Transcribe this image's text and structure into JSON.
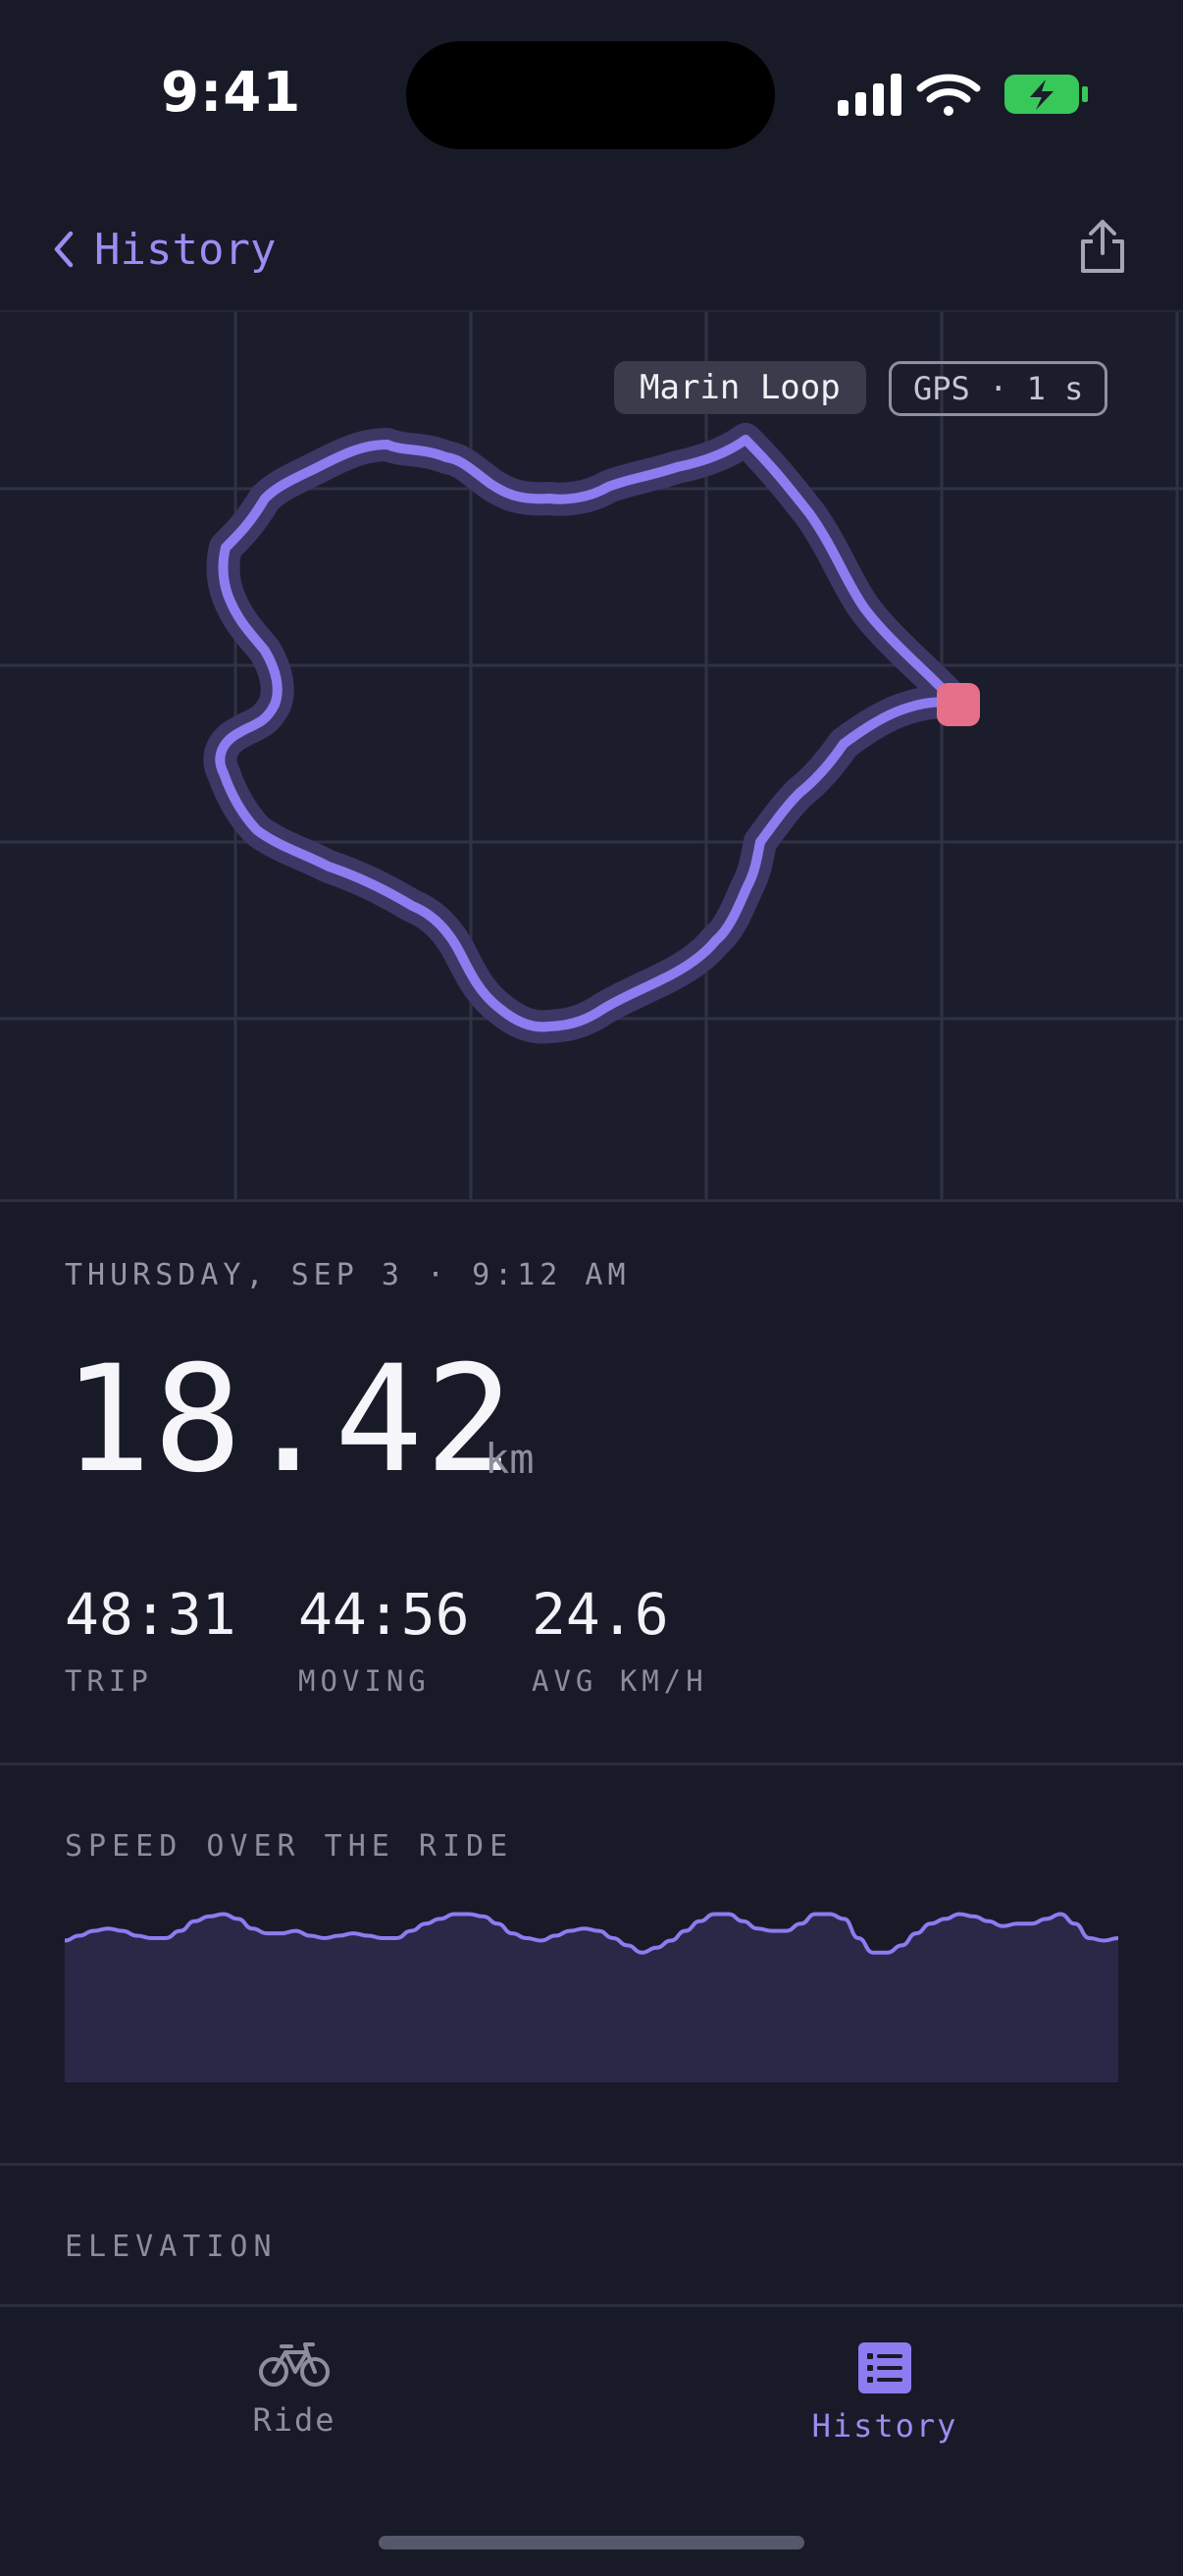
{
  "status_bar": {
    "time": "9:41"
  },
  "nav": {
    "back_label": "History"
  },
  "map": {
    "route_name": "Marin Loop",
    "gps_label": "GPS · 1 s",
    "colors": {
      "route": "#8b7cf0",
      "route_halo": "#3d3766",
      "marker": "#e6708a",
      "grid": "#2f3244"
    }
  },
  "ride": {
    "date": "THURSDAY, SEP 3 · 9:12 AM",
    "distance": "18.42",
    "distance_unit": "km",
    "stats": [
      {
        "value": "48:31",
        "label": "TRIP"
      },
      {
        "value": "44:56",
        "label": "MOVING"
      },
      {
        "value": "24.6",
        "label": "AVG KM/H"
      }
    ]
  },
  "sections": {
    "speed_title": "SPEED OVER THE RIDE",
    "elevation_title": "ELEVATION"
  },
  "chart_data": {
    "type": "area",
    "title": "SPEED OVER THE RIDE",
    "xlabel": "",
    "ylabel": "",
    "values": [
      20,
      22,
      24,
      25,
      24,
      22,
      21,
      21,
      24,
      28,
      30,
      31,
      29,
      25,
      23,
      23,
      24,
      22,
      21,
      22,
      23,
      22,
      21,
      21,
      24,
      27,
      29,
      31,
      31,
      30,
      27,
      23,
      21,
      20,
      22,
      24,
      25,
      24,
      21,
      18,
      15,
      17,
      20,
      24,
      28,
      31,
      31,
      28,
      25,
      24,
      24,
      27,
      31,
      31,
      29,
      21,
      15,
      15,
      18,
      23,
      27,
      29,
      31,
      30,
      28,
      26,
      27,
      27,
      29,
      31,
      27,
      21,
      20,
      21
    ],
    "grid": false,
    "colors": {
      "line": "#8b7cf0",
      "fill": "#2a2847"
    }
  },
  "tabs": [
    {
      "label": "Ride",
      "icon": "bicycle-icon",
      "active": false
    },
    {
      "label": "History",
      "icon": "list-icon",
      "active": true
    }
  ]
}
